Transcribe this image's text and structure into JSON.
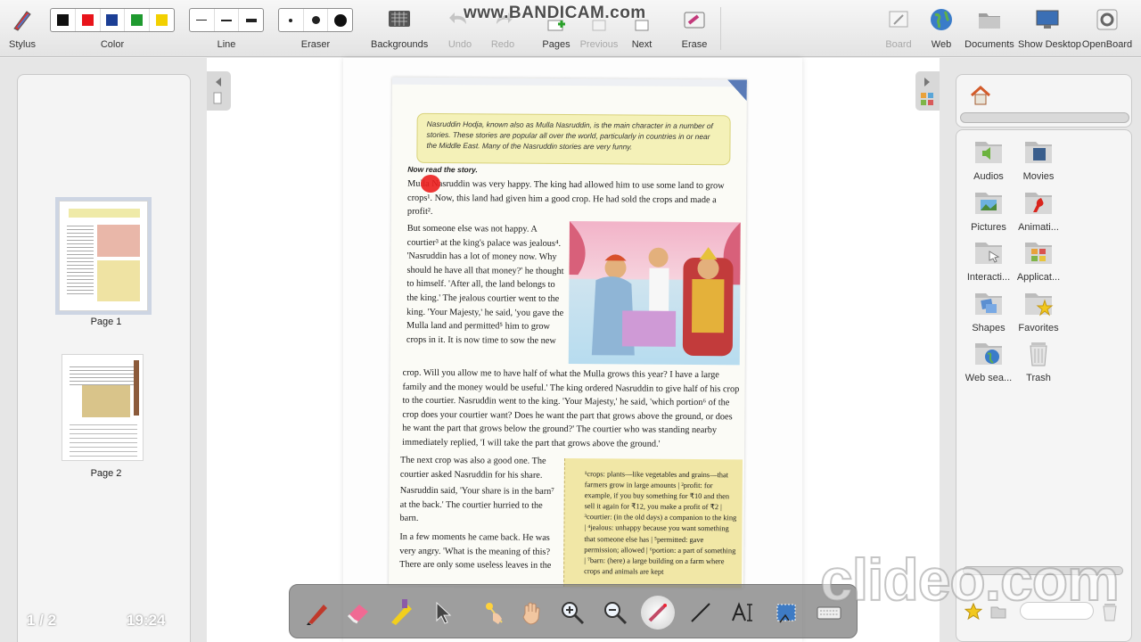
{
  "watermark": "www.BANDICAM.com",
  "toolbar": {
    "stylus": "Stylus",
    "color": "Color",
    "line": "Line",
    "eraser": "Eraser",
    "backgrounds": "Backgrounds",
    "undo": "Undo",
    "redo": "Redo",
    "pages": "Pages",
    "previous": "Previous",
    "next": "Next",
    "erase": "Erase",
    "board": "Board",
    "web": "Web",
    "documents": "Documents",
    "show_desktop": "Show Desktop",
    "openboard": "OpenBoard",
    "colors": [
      "#111111",
      "#e8141b",
      "#1c3f95",
      "#1f9a2f",
      "#f2d000"
    ]
  },
  "pages_panel": {
    "pages": [
      {
        "label": "Page 1"
      },
      {
        "label": "Page 2"
      }
    ],
    "counter": "1 / 2",
    "clock": "19:24"
  },
  "document": {
    "intro": "Nasruddin Hodja, known also as Mulla Nasruddin, is the main character in a number of stories. These stories are popular all over the world, particularly in countries in or near the Middle East. Many of the Nasruddin stories are very funny.",
    "now_read": "Now read the story.",
    "p1": "Mulla Nasruddin was very happy. The king had allowed him to use some land to grow crops¹. Now, this land had given him a good crop. He had sold the crops and made a profit².",
    "p2": "But someone else was not happy. A courtier³ at the king's palace was jealous⁴. 'Nasruddin has a lot of money now. Why should he have all that money?' he thought to himself. 'After all, the land belongs to the king.' The jealous courtier went to the king. 'Your Majesty,' he said, 'you gave the Mulla land and permitted⁵ him to grow crops in it. It is now time to sow the new",
    "p3": "crop. Will you allow me to have half of what the Mulla grows this year? I have a large family and the money would be useful.' The king ordered Nasruddin to give half of his crop to the courtier. Nasruddin went to the king. 'Your Majesty,' he said, 'which portion⁶ of the crop does your courtier want? Does he want the part that grows above the ground, or does he want the part that grows below the ground?' The courtier who was standing nearby immediately replied, 'I will take the part that grows above the ground.'",
    "p4": "The next crop was also a good one. The courtier asked Nasruddin for his share.",
    "p5": "Nasruddin said, 'Your share is in the barn⁷ at the back.' The courtier hurried to the barn.",
    "p6": "In a few moments he came back. He was very angry. 'What is the meaning of this? There are only some useless leaves in the",
    "glossary": "¹crops: plants—like vegetables and grains—that farmers grow in large amounts | ²profit: for example, if you buy something for ₹10 and then sell it again for ₹12, you make a profit of ₹2 | ³courtier: (in the old days) a companion to the king | ⁴jealous: unhappy because you want something that someone else has | ⁵permitted: gave permission; allowed | ⁶portion: a part of something | ⁷barn: (here) a large building on a farm where crops and animals are kept"
  },
  "library": {
    "items": [
      {
        "label": "Audios",
        "icon": "audio-folder-icon"
      },
      {
        "label": "Movies",
        "icon": "movie-folder-icon"
      },
      {
        "label": "Pictures",
        "icon": "pictures-folder-icon"
      },
      {
        "label": "Animati...",
        "icon": "animation-folder-icon"
      },
      {
        "label": "Interacti...",
        "icon": "interactivity-folder-icon"
      },
      {
        "label": "Applicat...",
        "icon": "applications-folder-icon"
      },
      {
        "label": "Shapes",
        "icon": "shapes-folder-icon"
      },
      {
        "label": "Favorites",
        "icon": "favorites-folder-icon"
      },
      {
        "label": "Web sea...",
        "icon": "web-search-folder-icon"
      },
      {
        "label": "Trash",
        "icon": "trash-icon"
      }
    ]
  },
  "clideo_watermark": "clideo.com"
}
